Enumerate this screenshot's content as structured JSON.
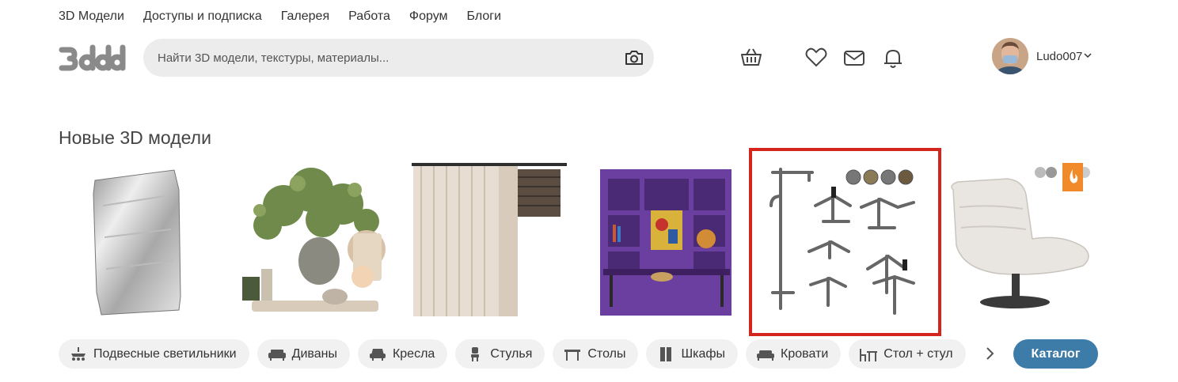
{
  "nav": {
    "items": [
      "3D Модели",
      "Доступы и подписка",
      "Галерея",
      "Работа",
      "Форум",
      "Блоги"
    ]
  },
  "logo": {
    "icon": "3ddd-logo"
  },
  "search": {
    "placeholder": "Найти 3D модели, текстуры, материалы...",
    "value": "",
    "icon": "camera-icon"
  },
  "header_icons": [
    "cart-icon",
    "heart-icon",
    "mail-icon",
    "bell-icon"
  ],
  "user": {
    "name": "Ludo007",
    "icon": "chevron-down-icon"
  },
  "section": {
    "title": "Новые 3D модели"
  },
  "models": [
    {
      "name": "foil-bag"
    },
    {
      "name": "plant-decor-set"
    },
    {
      "name": "curtains-blinds"
    },
    {
      "name": "purple-bookcase"
    },
    {
      "name": "bath-faucets-set",
      "highlighted": true
    },
    {
      "name": "white-lounge-chair",
      "badge": "flame-badge"
    }
  ],
  "categories": [
    {
      "label": "Подвесные светильники",
      "icon": "chandelier-icon"
    },
    {
      "label": "Диваны",
      "icon": "sofa-icon"
    },
    {
      "label": "Кресла",
      "icon": "armchair-icon"
    },
    {
      "label": "Стулья",
      "icon": "chair-icon"
    },
    {
      "label": "Столы",
      "icon": "table-icon"
    },
    {
      "label": "Шкафы",
      "icon": "wardrobe-icon"
    },
    {
      "label": "Кровати",
      "icon": "bed-icon"
    },
    {
      "label": "Стол + стул",
      "icon": "table-chair-icon"
    }
  ],
  "catalog_button": "Каталог",
  "colors": {
    "accent": "#3d7ba8",
    "highlight": "#d3251d",
    "search_bg": "#ececec",
    "chip_bg": "#f1f1f1"
  }
}
